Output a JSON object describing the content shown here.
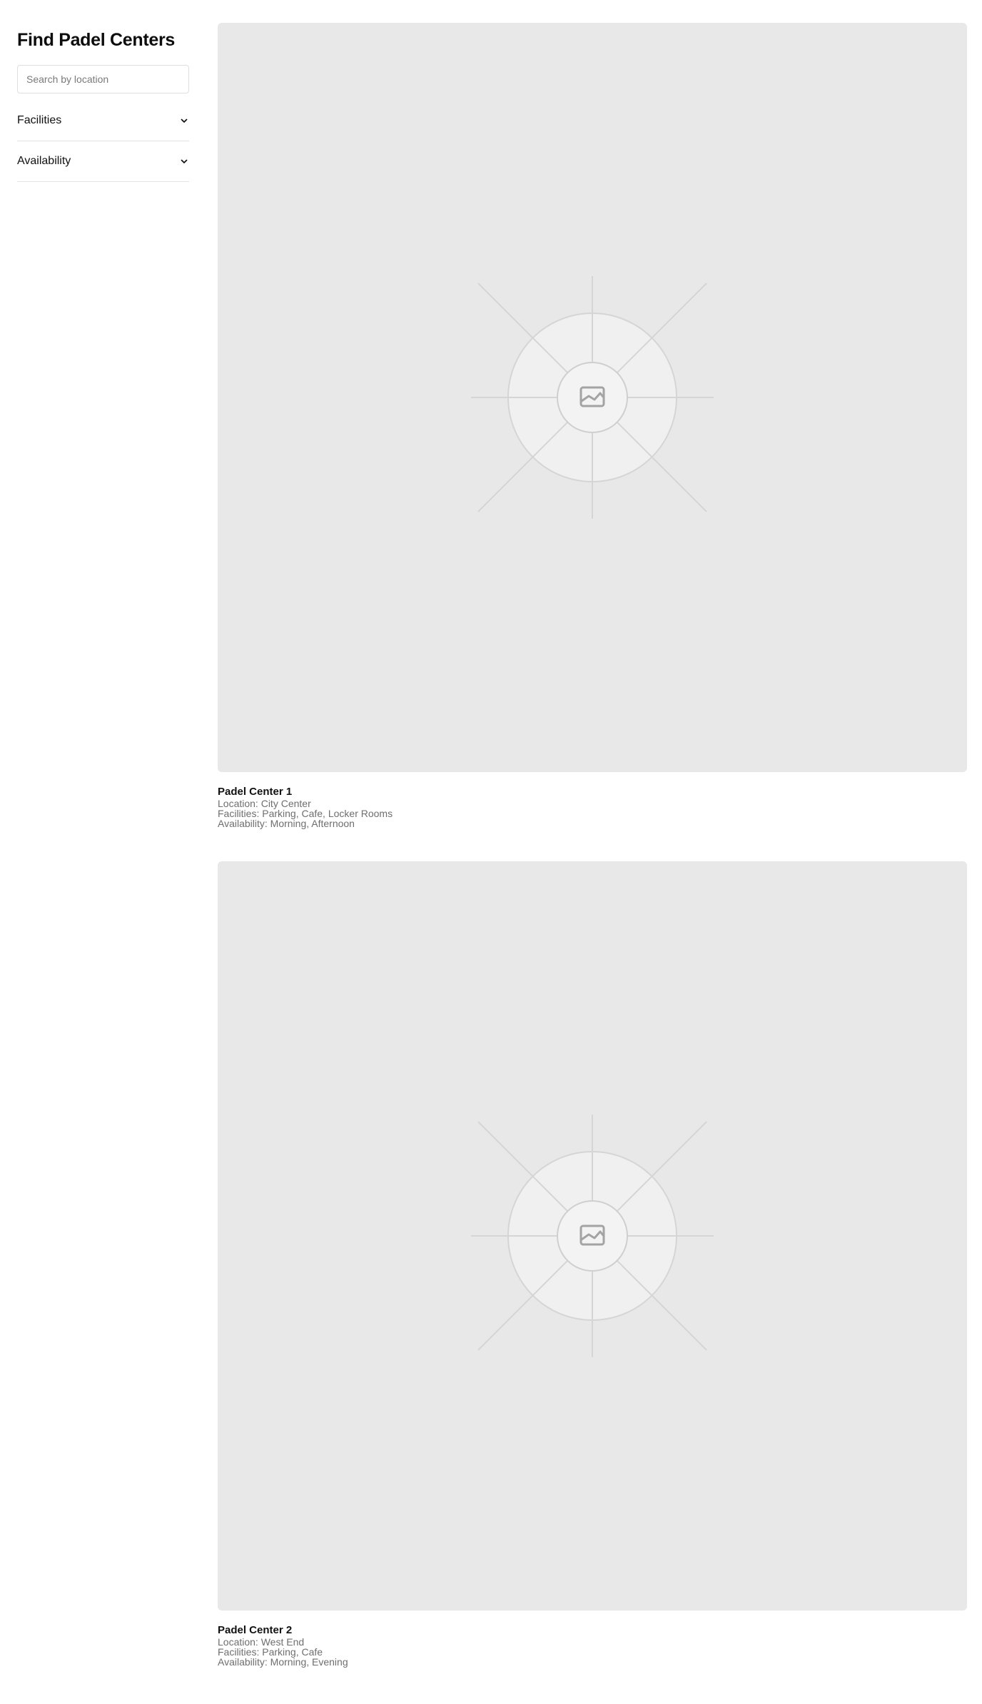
{
  "sidebar": {
    "title": "Find Padel Centers",
    "search": {
      "placeholder": "Search by location",
      "value": ""
    },
    "filters": [
      {
        "label": "Facilities",
        "icon": "chevron-down-icon"
      },
      {
        "label": "Availability",
        "icon": "chevron-down-icon"
      }
    ]
  },
  "centers": [
    {
      "name": "Padel Center 1",
      "location": "Location: City Center",
      "facilities": "Facilities: Parking, Cafe, Locker Rooms",
      "availability": "Availability: Morning, Afternoon",
      "image_icon": "image-placeholder-icon"
    },
    {
      "name": "Padel Center 2",
      "location": "Location: West End",
      "facilities": "Facilities: Parking, Cafe",
      "availability": "Availability: Morning, Evening",
      "image_icon": "image-placeholder-icon"
    }
  ],
  "colors": {
    "image_background": "#e8e8e8",
    "text_primary": "#111111",
    "text_secondary": "#6e6e6e",
    "divider": "#e3e3e3"
  }
}
